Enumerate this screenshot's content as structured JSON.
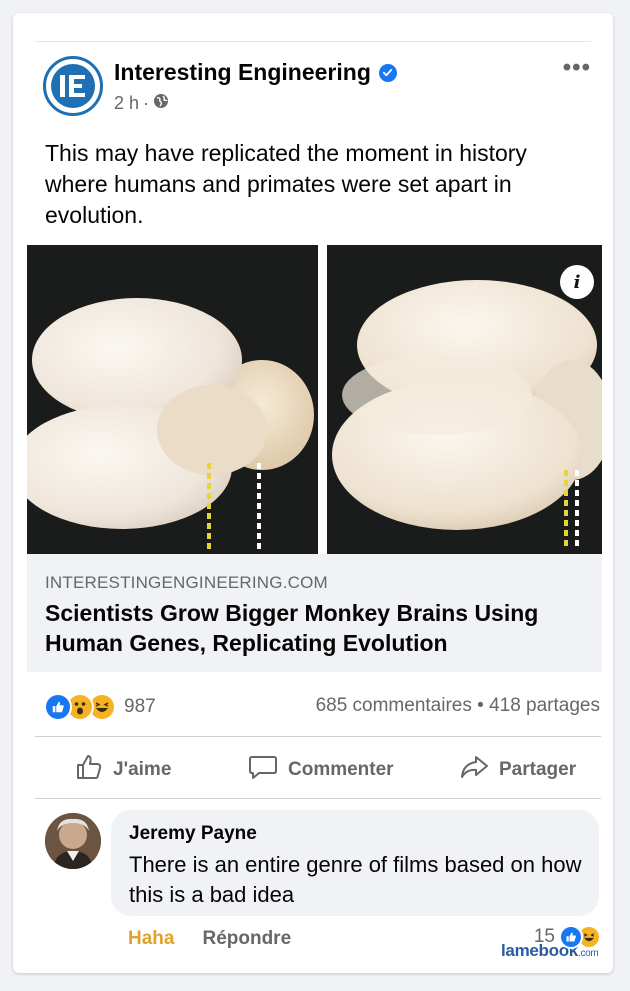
{
  "post": {
    "page_name": "Interesting Engineering",
    "time": "2 h",
    "separator": "·",
    "icons": {
      "logo": "IE-logo-icon",
      "verified": "verified-check-icon",
      "audience": "globe-icon",
      "more": "ellipsis-icon"
    },
    "more_label": "•••",
    "text": "This may have replicated the moment in history where humans and primates were set apart in evolution.",
    "info_label": "i"
  },
  "link": {
    "domain": "INTERESTINGENGINEERING.COM",
    "title": "Scientists Grow Bigger Monkey Brains Using Human Genes, Replicating Evolution"
  },
  "engagement": {
    "reaction_icons": [
      "like-icon",
      "wow-icon",
      "haha-icon"
    ],
    "reaction_count": "987",
    "stats": "685 commentaires • 418 partages"
  },
  "actions": {
    "like": "J'aime",
    "comment": "Commenter",
    "share": "Partager"
  },
  "comment": {
    "author": "Jeremy Payne",
    "text": "There is an entire genre of films based on how this is a bad idea",
    "reaction_link": "Haha",
    "reply_link": "Répondre",
    "reaction_count": "15",
    "reaction_icons": [
      "like-icon",
      "haha-icon"
    ]
  },
  "watermark": {
    "brand": "lamebook",
    "suffix": ".com"
  },
  "colors": {
    "accent": "#1877f2",
    "haha": "#e0a22b",
    "secondary_text": "#65676b",
    "logo_blue": "#1e6fb3"
  }
}
